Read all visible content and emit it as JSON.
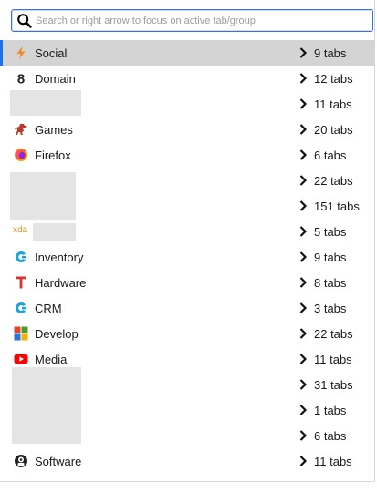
{
  "search": {
    "placeholder": "Search or right arrow to focus on active tab/group",
    "value": ""
  },
  "groups": [
    {
      "label": "Social",
      "count": "9 tabs",
      "icon": "lightning-icon",
      "active": true
    },
    {
      "label": "Domain",
      "count": "12 tabs",
      "icon": "domain-8-icon"
    },
    {
      "label": "",
      "count": "11 tabs",
      "icon": "redacted"
    },
    {
      "label": "Games",
      "count": "20 tabs",
      "icon": "dinosaur-icon"
    },
    {
      "label": "Firefox",
      "count": "6 tabs",
      "icon": "firefox-icon"
    },
    {
      "label": "",
      "count": "22 tabs",
      "icon": "redacted"
    },
    {
      "label": "",
      "count": "151 tabs",
      "icon": "redacted"
    },
    {
      "label": "",
      "count": "5 tabs",
      "icon": "xda-logo-icon",
      "icon_text": "xda"
    },
    {
      "label": "Inventory",
      "count": "9 tabs",
      "icon": "c-logo-icon"
    },
    {
      "label": "Hardware",
      "count": "8 tabs",
      "icon": "t-logo-icon"
    },
    {
      "label": "CRM",
      "count": "3 tabs",
      "icon": "c-logo-icon"
    },
    {
      "label": "Develop",
      "count": "22 tabs",
      "icon": "windows-tiles-icon"
    },
    {
      "label": "Media",
      "count": "11 tabs",
      "icon": "youtube-icon"
    },
    {
      "label": "",
      "count": "31 tabs",
      "icon": "redacted"
    },
    {
      "label": "",
      "count": "1 tabs",
      "icon": "redacted"
    },
    {
      "label": "",
      "count": "6 tabs",
      "icon": "redacted"
    },
    {
      "label": "Software",
      "count": "11 tabs",
      "icon": "software-icon"
    }
  ],
  "colors": {
    "accent": "#1a73e8",
    "active_row": "#d4d4d4",
    "search_border": "#3f6fd8",
    "redacted": "#e4e4e4"
  }
}
